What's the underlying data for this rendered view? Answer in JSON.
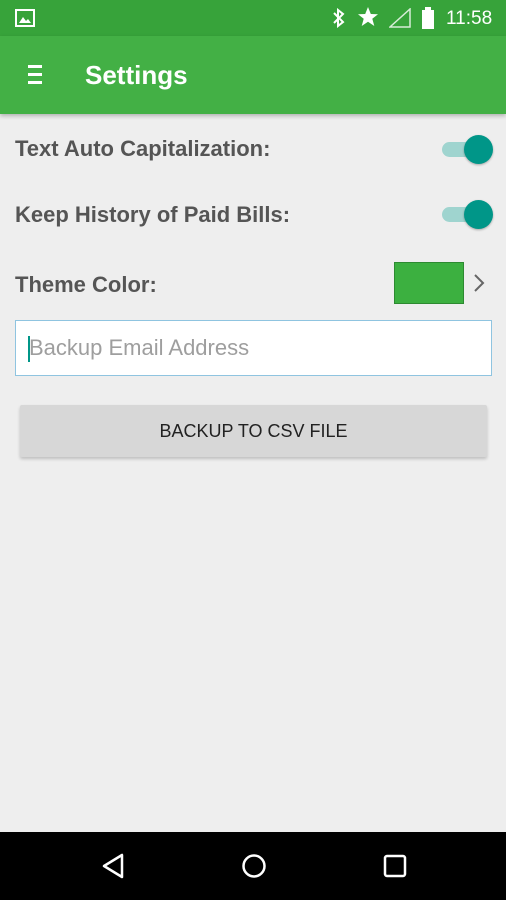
{
  "status_bar": {
    "time": "11:58",
    "icons": [
      "gallery-icon",
      "bluetooth-icon",
      "star-icon",
      "signal-icon",
      "battery-icon"
    ]
  },
  "app_bar": {
    "title": "Settings",
    "menu_icon": "menu-icon",
    "background": "#43b045"
  },
  "settings": {
    "text_auto_capitalization": {
      "label": "Text Auto Capitalization:",
      "enabled": true
    },
    "keep_history": {
      "label": "Keep History of Paid Bills:",
      "enabled": true
    },
    "theme_color": {
      "label": "Theme Color:",
      "color": "#3cb040"
    }
  },
  "backup": {
    "email_placeholder": "Backup Email Address",
    "email_value": "",
    "button_label": "BACKUP TO CSV FILE"
  },
  "nav_bar": {
    "icons": [
      "back-icon",
      "home-icon",
      "recents-icon"
    ]
  },
  "colors": {
    "status_bar": "#37a33a",
    "accent": "#009688",
    "background": "#eeeeee"
  }
}
